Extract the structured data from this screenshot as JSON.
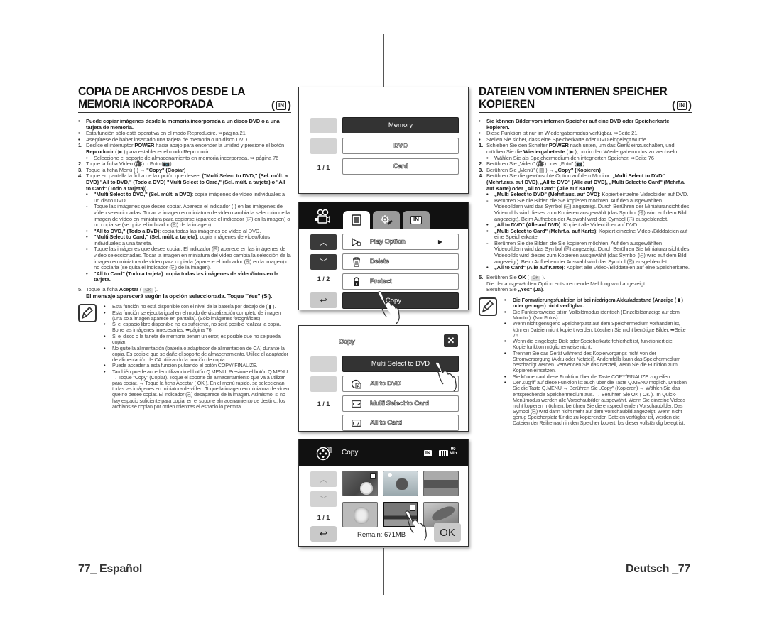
{
  "es": {
    "title_line1": "COPIA DE ARCHIVOS DESDE LA",
    "title_line2": "MEMORIA INCORPORADA",
    "badge": "IN",
    "intro_bold": "Puede copiar imágenes desde la memoria incorporada a un disco DVD o a una tarjeta de memoria.",
    "bullet1": "Esta función sólo está operativa en el modo Reproducire. ➥página 21",
    "bullet2": "Asegúrese de haber insertado una tarjeta de memoria o un disco DVD.",
    "step1_a": "Deslice el interruptor ",
    "step1_b": "POWER",
    "step1_c": " hacia abajo para encender la unidad y presione el botón ",
    "step1_d": "Reproducir",
    "step1_e": " ( ▶ ) para establecer el modo Reproducir.",
    "step1_sub": "Seleccione el soporte de almacenamiento en memoria incorporada. ➥ página 76",
    "step2": "Toque la ficha Vídeo (🎥) o Foto (📷).",
    "step3_a": "Toque la ficha Menú (      ) → ",
    "step3_b": "\"Copy\" (Copiar)",
    "step4_a": "Toque en pantalla la ficha de la opción que desee. ",
    "step4_b": "(\"Multi Select to DVD,\" (Sel. múlt. a DVD) \"All to DVD,\" (Todo a DVD) \"Multi Select to Card,\" (Sel. múlt. a tarjeta) o \"All to Card\" (Todo a tarjeta)).",
    "sub1_b": "\"Multi Select to DVD,\" (Sel. múlt. a DVD)",
    "sub1_t": ": copia imágenes de vídeo individuales a un disco DVD.",
    "sub1_dash": "Toque las imágenes que desee copiar. Aparece el indicador (   ) en las imágenes de vídeo seleccionadas. Tocar la imagen en miniatura de vídeo cambia la selección de la imagen de vídeo en miniatura para copiarse (aparece el indicador (⎘) en la imagen) o no copiarse (se quita el indicador (⎘) de la imagen).",
    "sub2_b": "\"All to DVD,\" (Todo a DVD)",
    "sub2_t": ": copia todas las imágenes de vídeo al DVD.",
    "sub3_b": "\"Multi Select to Card,\" (Sel. múlt. a tarjeta)",
    "sub3_t": ": copia imágenes de vídeo/fotos individuales a una tarjeta.",
    "sub3_dash": "Toque las imágenes que desee copiar. El indicador (⎘) aparece en las imágenes de vídeo seleccionadas. Tocar la imagen en miniatura del vídeo cambia la selección de la imagen en miniatura de vídeo para copiarla (aparece el indicador (⎘) en la imagen) o no copiarla (se quita el indicador (⎘) de la imagen).",
    "sub4": "\"All to Card\" (Todo a tarjeta): copia todas las imágenes de vídeo/fotos en la tarjeta.",
    "step5_a": "Toque la ficha ",
    "step5_b": "Aceptar",
    "step5_ok": "OK",
    "step5_bold": "El mensaje aparecerá según la opción seleccionada. Toque \"Yes\" (Sí).",
    "notes": [
      "Esta función no está disponible con el nivel de la batería por debajo de ( ▮ ).",
      "Esta función se ejecuta igual en el modo de visualización completo de imagen (una sola imagen aparece en pantalla). (Sólo imágenes fotográficas)",
      "Si el espacio libre disponible no es suficiente, no será posible realizar la copia. Borre las imágenes innecesarias. ➥página 76",
      "Si el disco o la tarjeta de memoria tienen un error, es posible que no se pueda copiar.",
      "No quite la alimentación (batería o adaptador de alimentación de CA) durante la copia. Es posible que se dañe el soporte de almacenamiento. Utilice el adaptador de alimentación de CA utilizando la función de copia.",
      "Puede acceder a esta función pulsando el botón COPY/ FINALIZE.",
      "También puede acceder utilizando el botón Q.MENU. Presione el botón Q.MENU → Toque \"Copy\" (Copiar). Toque el soporte de almacenamiento que va a utilizar para copiar. → Toque la ficha Aceptar ( OK ). En el menú rápido, se seleccionan todas las imágenes en miniatura de vídeo. Toque la imagen en miniatura de vídeo que no desee copiar. El indicador (⎘) desaparece de la imagen. Asimismo, si no hay espacio suficiente para copiar en el soporte almacenamiento de destino, los archivos se copian por orden mientras el espacio lo permita."
    ],
    "footer": "77_ Español"
  },
  "de": {
    "title_line1": "DATEIEN VOM INTERNEN SPEICHER",
    "title_line2": "KOPIEREN",
    "badge": "IN",
    "intro_bold": "Sie können Bilder vom internen Speicher auf eine DVD oder Speicherkarte kopieren.",
    "bullet1": "Diese Funktion ist nur im Wiedergabemodus verfügbar. ➥Seite 21",
    "bullet2": "Stellen Sie sicher, dass eine Speicherkarte oder DVD eingelegt wurde.",
    "step1_a": "Schieben Sie den Schalter ",
    "step1_b": "POWER",
    "step1_c": " nach unten, um das Gerät einzuschalten, und drücken Sie die ",
    "step1_d": "Wiedergabetaste",
    "step1_e": " ( ▶ ), um in den Wiedergabemodus zu wechseln.",
    "step1_sub": "Wählen Sie als Speichermedium den integrierten Speicher. ➥Seite 76",
    "step2": "Berühren Sie „Video\" (🎥) oder „Foto\" (📷).",
    "step3_a": "Berühren Sie „Menü\" ( ▤ ) → ",
    "step3_b": "„Copy\" (Kopieren)",
    "step4_a": "Berühren Sie die gewünschte Option auf dem Monitor: ",
    "step4_b": "„Multi Select to DVD\" (Mehrf.aus. auf DVD), „All to DVD\" (Alle auf DVD), „Multi Select to Card\" (Mehrf.a. auf Karte) oder „All to Card\" (Alle auf Karte)",
    "sub1_b": "„Multi Select to DVD\" (Mehrf.aus. auf DVD)",
    "sub1_t": ": Kopiert einzelne Videobilder auf DVD.",
    "sub1_dash": "Berühren Sie die Bilder, die Sie kopieren möchten. Auf den ausgewählten Videobildern wird das Symbol (⎘) angezeigt. Durch Berühren der Miniaturansicht des Videobilds wird dieses zum Kopieren ausgewählt (das Symbol (⎘) wird auf dem Bild angezeigt). Beim Aufheben der Auswahl wird das Symbol (⎘) ausgeblendet.",
    "sub2_b": "„All to DVD\" (Alle auf DVD)",
    "sub2_t": ": Kopiert alle Videobilder auf DVD.",
    "sub3_b": "„Multi Select to Card\" (Mehrf.a. auf Karte)",
    "sub3_t": ": Kopiert einzelne Video-/Bilddateien auf eine Speicherkarte.",
    "sub3_dash": "Berühren Sie die Bilder, die Sie kopieren möchten. Auf den ausgewählten Videobildern wird das Symbol (⎘) angezeigt. Durch Berühren Sie Miniaturansicht des Videobilds wird dieses zum Kopieren ausgewählt (das Symbol (⎘) wird auf dem Bild angezeigt). Beim Aufheben der Auswahl wird das Symbol (⎘) ausgeblendet.",
    "sub4_b": "„All to Card\" (Alle auf Karte)",
    "sub4_t": ": Kopiert alle Video-/Bilddateien auf eine Speicherkarte.",
    "step5_a": "Berühren Sie ",
    "step5_b": "OK",
    "step5_ok": "OK",
    "step5_t1": "Die der ausgewählten Option entsprechende Meldung wird angezeigt.",
    "step5_t2a": "Berühren Sie ",
    "step5_t2b": "„Yes\" (Ja)",
    "notes_bold": "Die Formatierungsfunktion ist bei niedrigem Akkuladestand (Anzeige ( ▮ ) oder geringer) nicht verfügbar.",
    "notes": [
      "Die Funktionsweise ist im Vollbildmodus identisch (Einzelbildanzeige auf dem Monitor). (Nur Fotos)",
      "Wenn nicht genügend Speicherplatz auf dem Speichermedium vorhanden ist, können Dateien nicht kopiert werden. Löschen Sie nicht benötigte Bilder. ➥Seite 76",
      "Wenn die eingelegte Disk oder Speicherkarte fehlerhaft ist, funktioniert die Kopierfunktion möglicherweise nicht.",
      "Trennen Sie das Gerät während des Kopiervorgangs nicht von der Stromversorgung (Akku oder Netzteil). Andernfalls kann das Speichermedium beschädigt werden. Verwenden Sie das Netzteil, wenn Sie die Funktion zum Kopieren einsetzen.",
      "Sie können auf diese Funktion über die Taste COPY/FINALIZE zugreifen.",
      "Der Zugriff auf diese Funktion ist auch über die Taste Q.MENU möglich. Drücken Sie die Taste Q.MENU → Berühren Sie „Copy\" (Kopieren) → Wählen Sie das entsprechende Speichermedium aus. → Berühren Sie OK ( OK ). Im Quick-Menümodus werden alle Vorschaubilder ausgewählt. Wenn Sie einzelne Videos nicht kopieren möchten, berühren Sie die entsprechenden Vorschaubilder. Das Symbol (⎘) wird dann nicht mehr auf dem Vorschaubild angezeigt. Wenn nicht genug Speicherplatz für die zu kopierenden Dateien verfügbar ist, werden die Dateien der Reihe nach in den Speicher kopiert, bis dieser vollständig belegt ist."
    ],
    "footer": "Deutsch _77"
  },
  "screen1": {
    "options": [
      "Memory",
      "DVD",
      "Card"
    ],
    "selected": "Memory",
    "page": "1 / 1"
  },
  "screen2": {
    "tabs": [
      "menu",
      "settings",
      "internal-memory"
    ],
    "active_tab": "menu",
    "tab_in_label": "IN",
    "items": [
      "Play Option",
      "Delete",
      "Protect",
      "Copy"
    ],
    "selected": "Copy",
    "page": "1 / 2"
  },
  "screen3": {
    "title": "Copy",
    "items": [
      "Multi Select to DVD",
      "All to DVD",
      "Multi Select to Card",
      "All to Card"
    ],
    "selected": "Multi Select to DVD",
    "page": "1 / 1"
  },
  "screen4": {
    "title": "Copy",
    "storage_badge": "IN",
    "battery_time": "90",
    "battery_unit": "Min",
    "page": "1 / 1",
    "remain": "Remain: 671MB",
    "ok_label": "OK",
    "thumbnails": [
      {
        "subject": "flower",
        "marked": true
      },
      {
        "subject": "snorkeler",
        "marked": false
      },
      {
        "subject": "landscape",
        "marked": false
      },
      {
        "subject": "puppy",
        "marked": false
      },
      {
        "subject": "seascape",
        "marked": true,
        "selected": true
      },
      {
        "subject": "dolphin",
        "marked": false
      }
    ]
  }
}
